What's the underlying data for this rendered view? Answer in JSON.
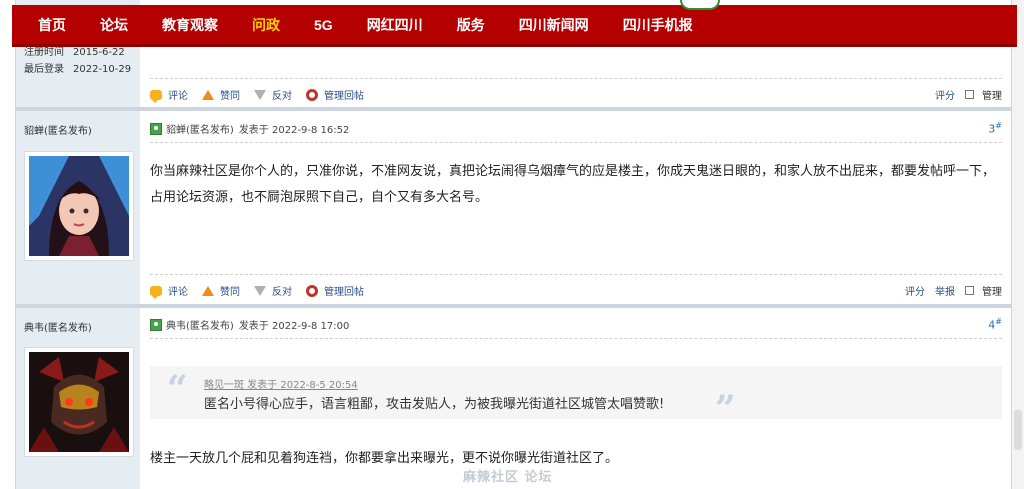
{
  "nav": {
    "items": [
      "首页",
      "论坛",
      "教育观察",
      "问政",
      "5G",
      "网红四川",
      "版务",
      "四川新闻网",
      "四川手机报"
    ],
    "active_index": 3
  },
  "colors": {
    "nav_bg": "#b40000",
    "nav_active": "#ffd200",
    "link": "#2a4e8a",
    "floor": "#2a6db4"
  },
  "post1": {
    "reg_label": "注册时间",
    "reg_value": "2015-6-22",
    "last_label": "最后登录",
    "last_value": "2022-10-29",
    "actions": {
      "comment": "评论",
      "like": "赞同",
      "oppose": "反对",
      "manage_reply": "管理回帖"
    },
    "right": {
      "rate": "评分",
      "manage": "管理"
    }
  },
  "post2": {
    "side_name": "貂蝉(匿名发布)",
    "head_author": "貂蝉(匿名发布)",
    "head_time": "发表于 2022-9-8 16:52",
    "floor": "3",
    "floor_mark": "#",
    "content": "你当麻辣社区是你个人的，只准你说，不准网友说，真把论坛闹得乌烟瘴气的应是楼主，你成天鬼迷日眼的，和家人放不出屁来，都要发帖呼一下，占用论坛资源，也不屙泡尿照下自己，自个又有多大名号。",
    "actions": {
      "comment": "评论",
      "like": "赞同",
      "oppose": "反对",
      "manage_reply": "管理回帖"
    },
    "right": {
      "rate": "评分",
      "report": "举报",
      "manage": "管理"
    }
  },
  "post3": {
    "side_name": "典韦(匿名发布)",
    "head_author": "典韦(匿名发布)",
    "head_time": "发表于 2022-9-8 17:00",
    "floor": "4",
    "floor_mark": "#",
    "quote_head": "略见一斑 发表于 2022-8-5 20:54",
    "quote_body": "匿名小号得心应手，语言粗鄙，攻击发贴人，为被我曝光街道社区城管太唱赞歌!",
    "content": "楼主一天放几个屁和见着狗连裆，你都要拿出来曝光，更不说你曝光街道社区了。"
  },
  "watermark": "麻辣社区 论坛"
}
